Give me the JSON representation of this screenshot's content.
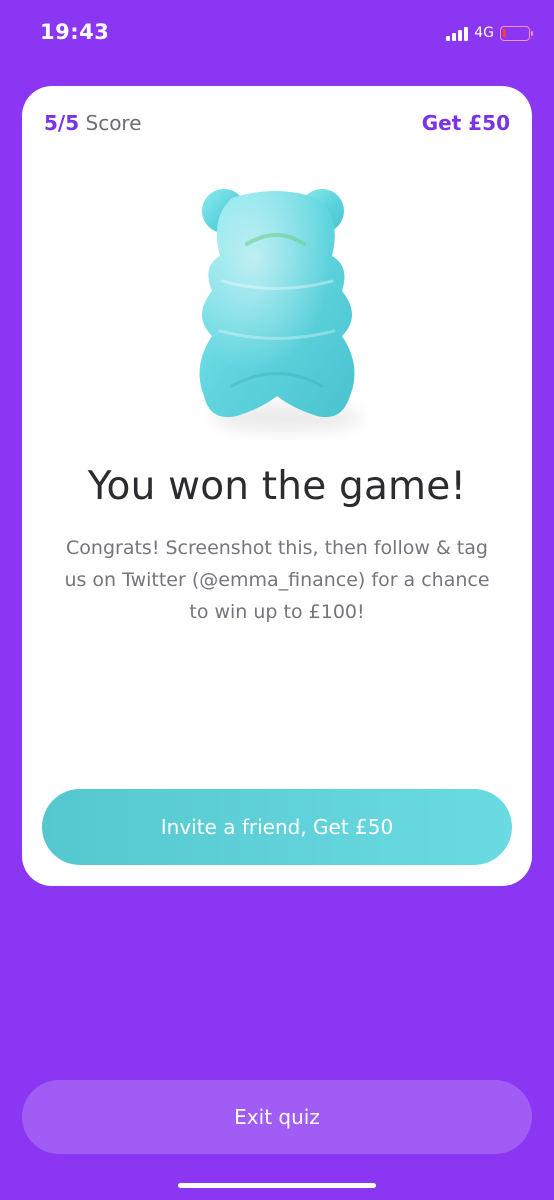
{
  "status_bar": {
    "time": "19:43",
    "network": "4G"
  },
  "card": {
    "score_value": "5/5",
    "score_label": "Score",
    "reward_link": "Get £50",
    "illustration": "gummy-bear-icon",
    "headline": "You won the game!",
    "message": "Congrats! Screenshot this, then follow & tag us on Twitter (@emma_finance) for a chance to win up to  £100!",
    "invite_button": "Invite a friend, Get £50"
  },
  "exit_button": "Exit quiz",
  "colors": {
    "background": "#8a36f2",
    "accent_purple": "#7b33e8",
    "teal": "#5fd1da",
    "exit_button": "#a05cf5"
  }
}
